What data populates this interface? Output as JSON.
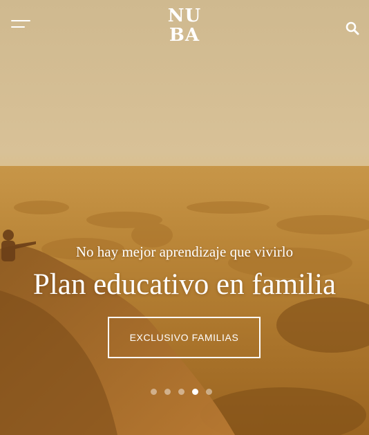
{
  "header": {
    "logo_line1": "NU",
    "logo_line2": "BA",
    "menu_icon": "hamburger-menu-icon",
    "search_icon": "search-icon"
  },
  "hero": {
    "image": "sunset-landscape-with-child-pointing",
    "tagline": "No hay mejor aprendizaje que vivirlo",
    "title": "Plan educativo en familia",
    "cta_label": "EXCLUSIVO FAMILIAS",
    "slides_count": 5,
    "active_slide": 4
  },
  "colors": {
    "text": "#ffffff",
    "sky": "#d9c096",
    "landscape": "#b7862f"
  }
}
